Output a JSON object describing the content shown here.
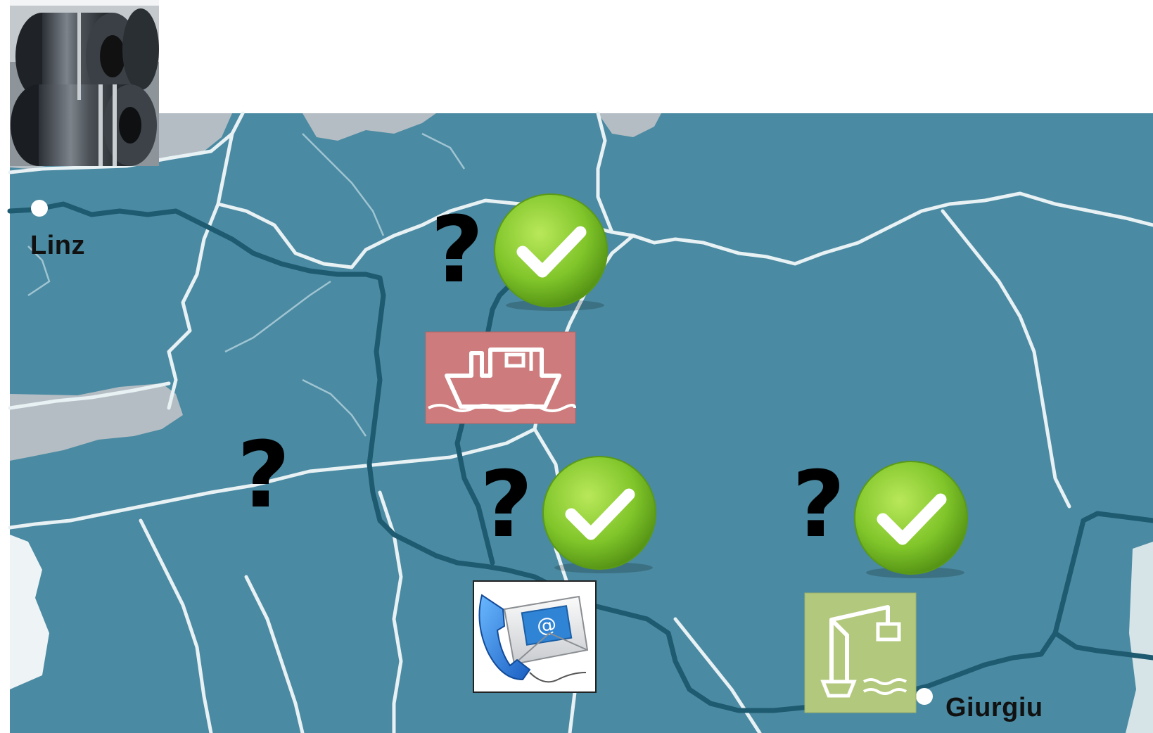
{
  "places": {
    "origin": {
      "label": "Linz"
    },
    "destination": {
      "label": "Giurgiu"
    }
  },
  "symbols": {
    "question_mark": "?",
    "check_icon": "check-circle-icon",
    "vessel_icon": "ship-icon",
    "contact_icon": "phone-email-icon",
    "port_icon": "port-crane-icon",
    "cargo_photo": "steel-coils-photo"
  },
  "colors": {
    "water": "#4a8aa2",
    "river": "#1f5c73",
    "border": "#e6f0f3",
    "neighbor_land": "#b3bcc2",
    "check_green": "#7cc224",
    "ship_box": "#cd7b7c",
    "port_box": "#b2c87c",
    "contact_blue": "#2a7fd8"
  }
}
